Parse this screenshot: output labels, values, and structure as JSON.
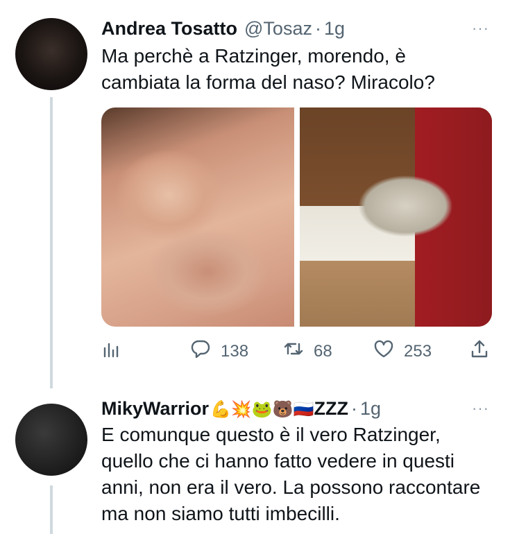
{
  "tweets": [
    {
      "author_name": "Andrea Tosatto",
      "handle": "@Tosaz",
      "separator": "·",
      "time": "1g",
      "more": "···",
      "text": "Ma perchè a Ratzinger, morendo, è cambiata la forma del naso? Miracolo?",
      "actions": {
        "reply_count": "138",
        "retweet_count": "68",
        "like_count": "253"
      }
    },
    {
      "author_name": "MikyWarrior",
      "name_emojis": "💪💥🐸🐻🇷🇺",
      "name_suffix": "ZZZ",
      "separator": "·",
      "time": "1g",
      "more": "···",
      "text": "E comunque questo è il vero Ratzinger, quello che ci hanno fatto vedere in questi anni, non era il vero. La possono raccontare ma non siamo tutti imbecilli."
    }
  ],
  "icons": {
    "views": "bar-chart-icon",
    "reply": "reply-bubble-icon",
    "retweet": "retweet-icon",
    "like": "heart-icon",
    "share": "share-upload-icon",
    "more": "more-dots-icon"
  },
  "colors": {
    "text": "#0f1419",
    "secondary": "#536471",
    "thread_line": "#cfd9de"
  }
}
